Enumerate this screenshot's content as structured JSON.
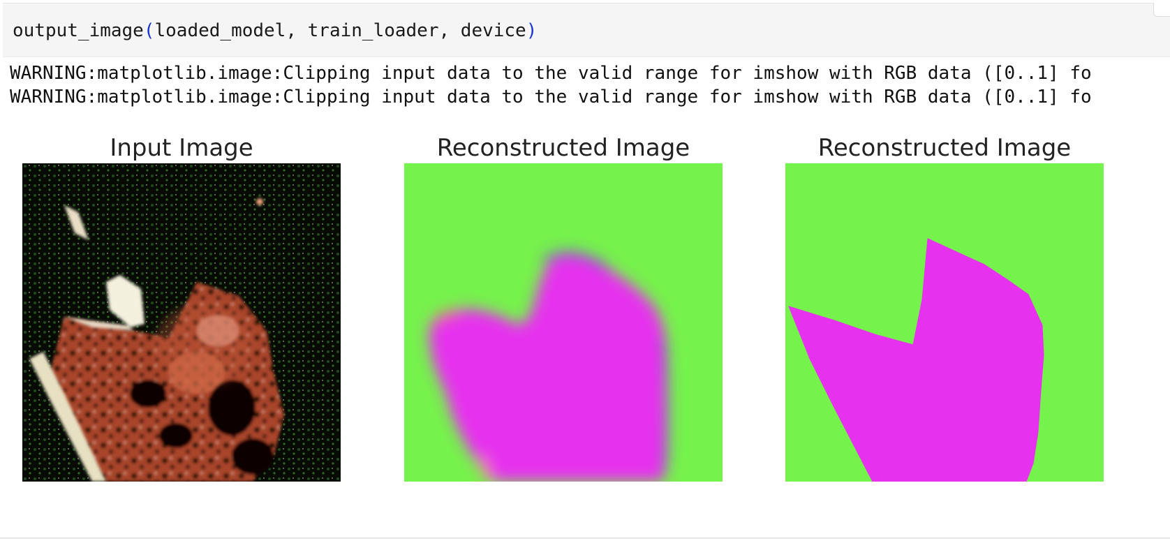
{
  "code_cell": {
    "function_name": "output_image",
    "open_paren": "(",
    "arguments": "loaded_model, train_loader, device",
    "close_paren": ")"
  },
  "output": {
    "warnings": [
      "WARNING:matplotlib.image:Clipping input data to the valid range for imshow with RGB data ([0..1] fo",
      "WARNING:matplotlib.image:Clipping input data to the valid range for imshow with RGB data ([0..1] fo"
    ],
    "panels": [
      {
        "title": "Input Image"
      },
      {
        "title": "Reconstructed Image"
      },
      {
        "title": "Reconstructed Image"
      }
    ]
  },
  "colors": {
    "mask_background": "#76f24c",
    "mask_foreground": "#e631ee",
    "code_paren": "#1a33d6",
    "cell_background": "#f5f5f5"
  }
}
